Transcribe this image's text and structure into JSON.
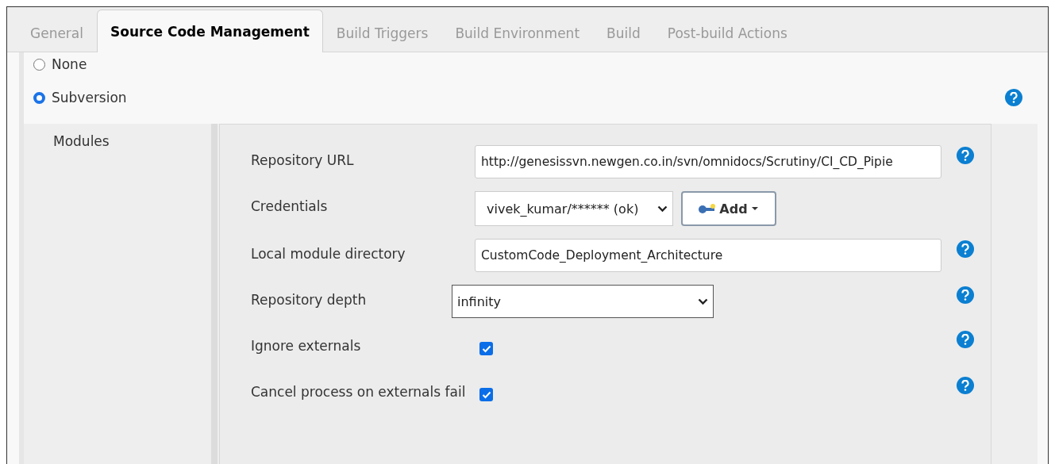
{
  "tabs": [
    {
      "label": "General",
      "selected": false
    },
    {
      "label": "Source Code Management",
      "selected": true
    },
    {
      "label": "Build Triggers",
      "selected": false
    },
    {
      "label": "Build Environment",
      "selected": false
    },
    {
      "label": "Build",
      "selected": false
    },
    {
      "label": "Post-build Actions",
      "selected": false
    }
  ],
  "scm_options": [
    {
      "label": "None",
      "selected": false,
      "help": false
    },
    {
      "label": "Subversion",
      "selected": true,
      "help": true
    }
  ],
  "modules": {
    "label": "Modules",
    "rows": [
      {
        "kind": "text",
        "label": "Repository URL",
        "value": "http://genesissvn.newgen.co.in/svn/omnidocs/Scrutiny/CI_CD_Pipie",
        "help": true
      },
      {
        "kind": "credentials",
        "label": "Credentials",
        "value": "vivek_kumar/****** (ok)",
        "button": "Add",
        "help": false
      },
      {
        "kind": "text",
        "label": "Local module directory",
        "value": "CustomCode_Deployment_Architecture",
        "help": true
      },
      {
        "kind": "select",
        "label": "Repository depth",
        "value": "infinity",
        "help": true
      },
      {
        "kind": "checkbox",
        "label": "Ignore externals",
        "checked": true,
        "help": true
      },
      {
        "kind": "checkbox",
        "label": "Cancel process on externals fail",
        "checked": true,
        "help": true
      }
    ]
  }
}
